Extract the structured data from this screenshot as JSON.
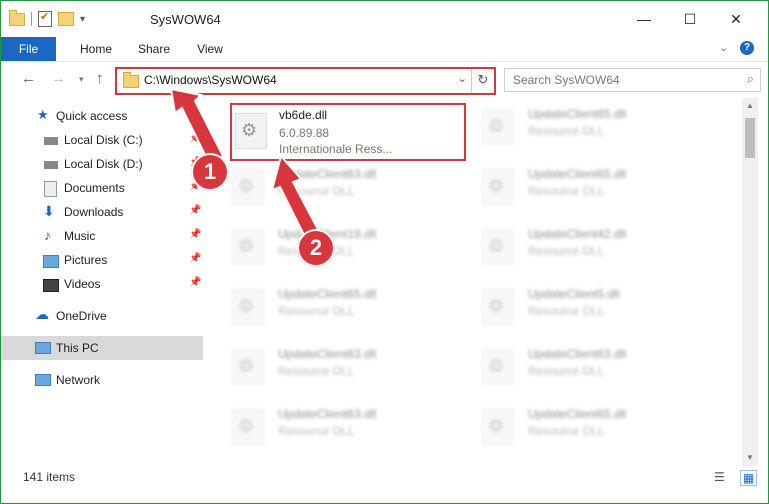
{
  "window": {
    "title": "SysWOW64"
  },
  "ribbon": {
    "tabs": [
      "File",
      "Home",
      "Share",
      "View"
    ]
  },
  "address": {
    "path": "C:\\Windows\\SysWOW64",
    "search_placeholder": "Search SysWOW64"
  },
  "sidebar": {
    "items": [
      {
        "label": "Quick access",
        "icon": "star-icon"
      },
      {
        "label": "Local Disk (C:)",
        "icon": "disk-icon"
      },
      {
        "label": "Local Disk (D:)",
        "icon": "disk-icon"
      },
      {
        "label": "Documents",
        "icon": "documents-icon"
      },
      {
        "label": "Downloads",
        "icon": "downloads-icon"
      },
      {
        "label": "Music",
        "icon": "music-icon"
      },
      {
        "label": "Pictures",
        "icon": "pictures-icon"
      },
      {
        "label": "Videos",
        "icon": "videos-icon"
      },
      {
        "label": "OneDrive",
        "icon": "cloud-icon"
      },
      {
        "label": "This PC",
        "icon": "computer-icon"
      },
      {
        "label": "Network",
        "icon": "network-icon"
      }
    ]
  },
  "files": {
    "highlighted": {
      "name": "vb6de.dll",
      "version": "6.0.89.88",
      "description": "Internationale Ress..."
    },
    "left": [
      {
        "name": "UpdateClient63.dll",
        "type": "Resource DLL"
      },
      {
        "name": "UpdateClient19.dll",
        "type": "Resource DLL"
      },
      {
        "name": "UpdateClient65.dll",
        "type": "Resource DLL"
      },
      {
        "name": "UpdateClient63.dll",
        "type": "Resource DLL"
      },
      {
        "name": "UpdateClient63.dll",
        "type": "Resource DLL"
      }
    ],
    "right": [
      {
        "name": "UpdateClient65.dll",
        "type": "Resource DLL"
      },
      {
        "name": "UpdateClient65.dll",
        "type": "Resource DLL"
      },
      {
        "name": "UpdateClient42.dll",
        "type": "Resource DLL"
      },
      {
        "name": "UpdateClient5.dll",
        "type": "Resource DLL"
      },
      {
        "name": "UpdateClient63.dll",
        "type": "Resource DLL"
      },
      {
        "name": "UpdateClient65.dll",
        "type": "Resource DLL"
      }
    ]
  },
  "status": {
    "count": "141 items"
  },
  "annotations": {
    "step1": "1",
    "step2": "2"
  },
  "colors": {
    "accent": "#1a68c4",
    "highlight": "#d9353c",
    "frame": "#1a9a3a"
  }
}
